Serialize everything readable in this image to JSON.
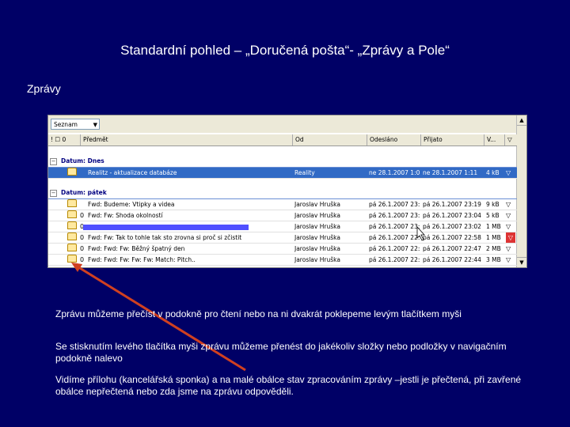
{
  "title": "Standardní pohled – „Doručená pošta“- „Zprávy a Pole“",
  "section_label": "Zprávy",
  "outlook": {
    "filter_label": "Seznam",
    "columns": {
      "icons": "! ☐ 0",
      "subject": "Předmět",
      "from": "Od",
      "sent": "Odesláno",
      "received": "Přijato",
      "size": "V...",
      "flag": "▽"
    },
    "groups": [
      {
        "label": "Datum: Dnes"
      },
      {
        "label": "Datum: pátek"
      }
    ],
    "today_rows": [
      {
        "subject": "Realitz - aktualizace databáze",
        "from": "Reality",
        "sent": "ne 28.1.2007 1:02",
        "received": "ne 28.1.2007 1:11",
        "size": "4 kB",
        "flag": "▽"
      }
    ],
    "friday_rows": [
      {
        "clip": "",
        "subject": "Fwd: Budeme: Vtipky a videa",
        "from": "Jaroslav Hruška",
        "sent": "pá 26.1.2007 23:19",
        "received": "pá 26.1.2007 23:19",
        "size": "9 kB",
        "flag": "▽"
      },
      {
        "clip": "0",
        "subject": "Fwd: Fw: Shoda okolností",
        "from": "Jaroslav Hruška",
        "sent": "pá 26.1.2007 23:04",
        "received": "pá 26.1.2007 23:04",
        "size": "5 kB",
        "flag": "▽"
      },
      {
        "clip": "0",
        "subject": "",
        "from": "Jaroslav Hruška",
        "sent": "pá 26.1.2007 23:02",
        "received": "pá 26.1.2007 23:02",
        "size": "1 MB",
        "flag": "▽"
      },
      {
        "clip": "0",
        "subject": "Fwd: Fw: Tak to tohle tak sto zrovna si proč si zčistit",
        "from": "Jaroslav Hruška",
        "sent": "pá 26.1.2007 22:58",
        "received": "pá 26.1.2007 22:58",
        "size": "1 MB",
        "flag": "▽"
      },
      {
        "clip": "0",
        "subject": "Fwd: Fwd: Fw: Běžný špatný den",
        "from": "Jaroslav Hruška",
        "sent": "pá 26.1.2007 22:47",
        "received": "pá 26.1.2007 22:47",
        "size": "2 MB",
        "flag": "▽"
      },
      {
        "clip": "0",
        "subject": "Fwd: Fwd: Fw: Fw: Fw: Match: Pitch..",
        "from": "Jaroslav Hruška",
        "sent": "pá 26.1.2007 22:44",
        "received": "pá 26.1.2007 22:44",
        "size": "3 MB",
        "flag": "▽"
      }
    ]
  },
  "paragraphs": [
    "Zprávu můžeme přečíst v podokně pro čtení nebo na ni dvakrát poklepeme levým tlačítkem myši",
    "Se stisknutím levého tlačítka myši zprávu můžeme přenést do jakékoliv složky nebo podložky v navigačním podokně nalevo",
    "Vidíme přílohu (kancelářská sponka) a na malé  obálce stav zpracováním zprávy –jestli je přečtená, při zavřené obálce nepřečtená nebo zda jsme na zprávu odpověděli."
  ],
  "colors": {
    "background": "#000066",
    "selection": "#316ac5",
    "arrow": "#d04020"
  }
}
